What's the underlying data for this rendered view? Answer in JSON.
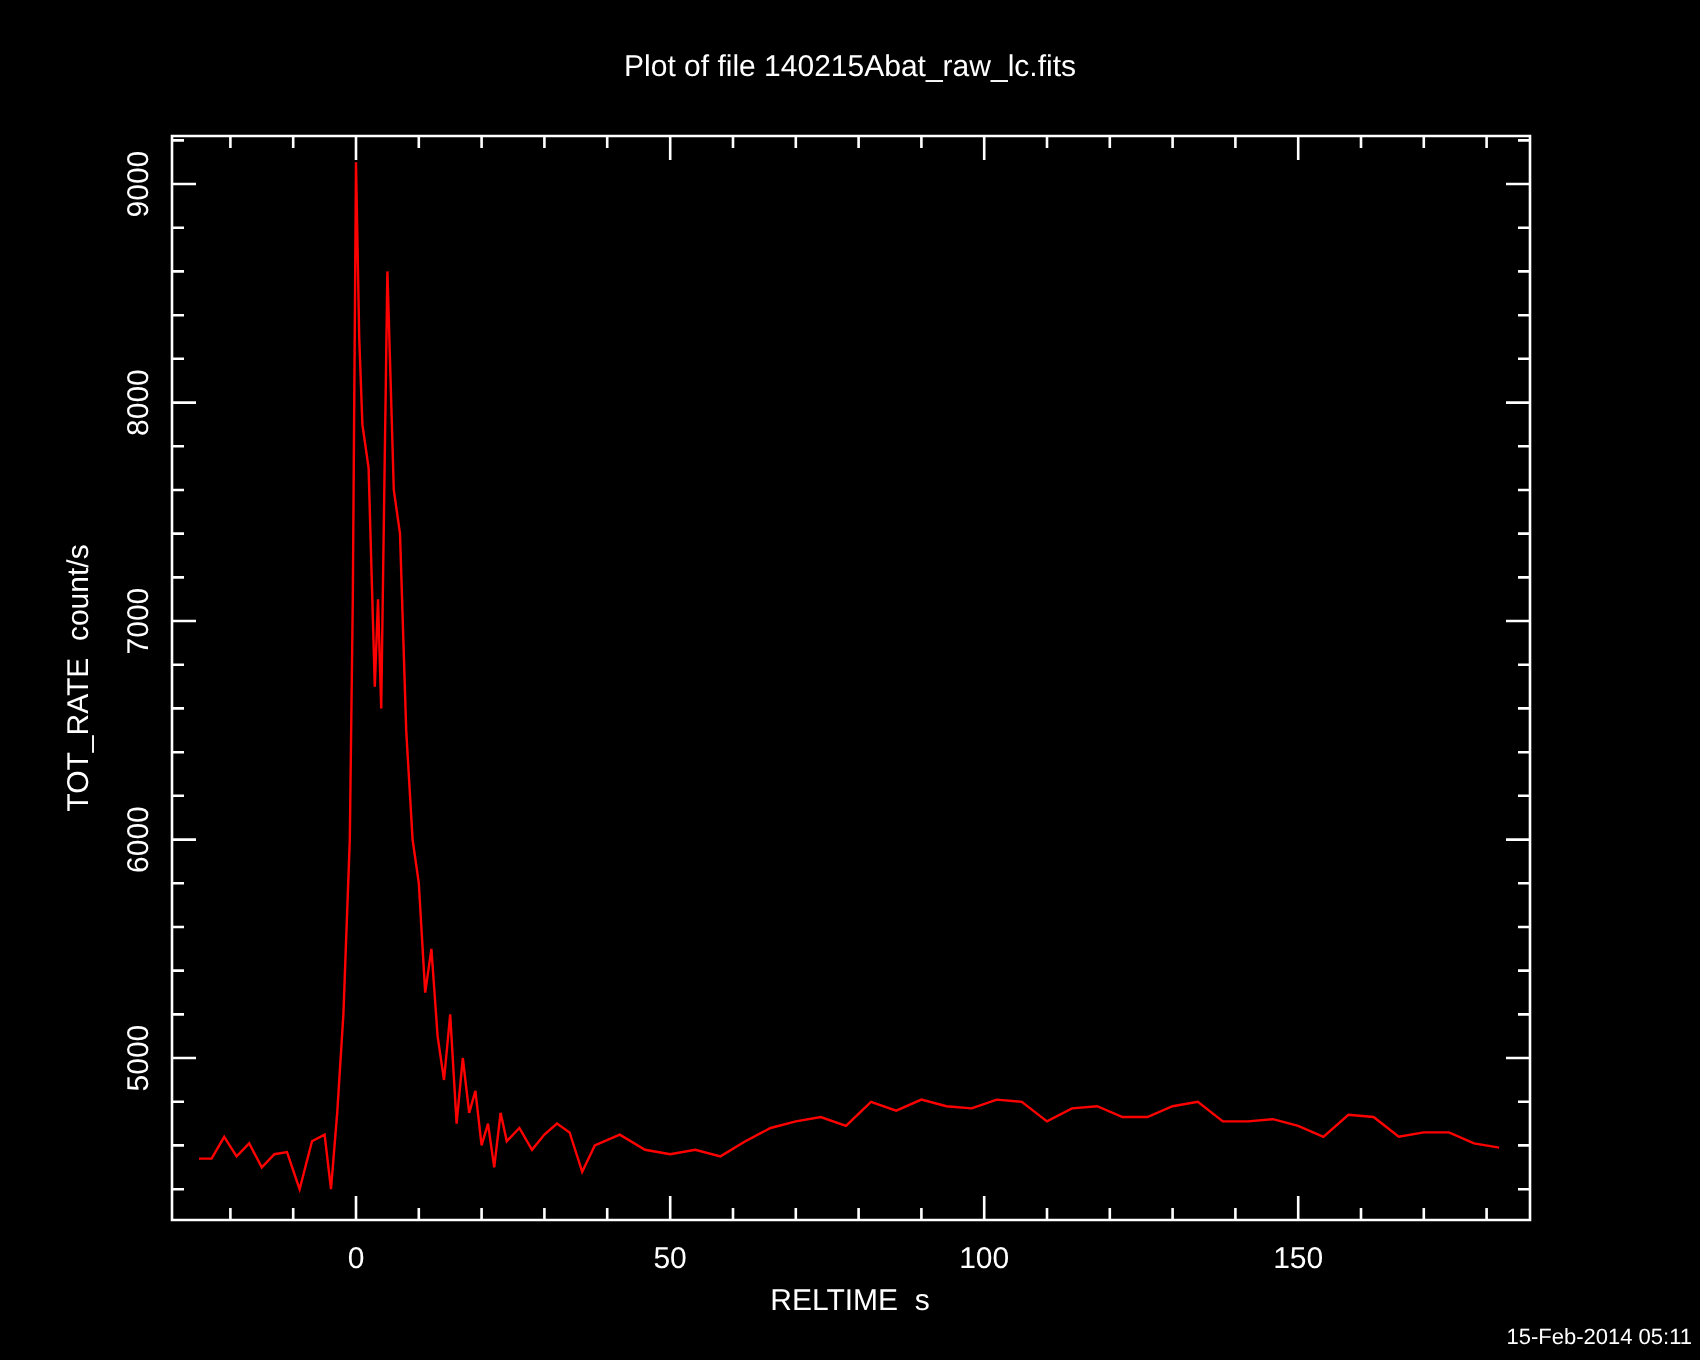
{
  "chart": {
    "chart_data": {
      "type": "line",
      "title": "Plot of file 140215Abat_raw_lc.fits",
      "xlabel": "RELTIME  s",
      "ylabel": "TOT_RATE  count/s",
      "x": [
        -25,
        -23,
        -21,
        -19,
        -17,
        -15,
        -13,
        -11,
        -9,
        -7,
        -5,
        -4,
        -3,
        -2,
        -1,
        -0.5,
        0,
        0.5,
        1,
        2,
        3,
        3.5,
        4,
        5,
        6,
        7,
        8,
        9,
        10,
        11,
        12,
        13,
        14,
        15,
        16,
        17,
        18,
        19,
        20,
        21,
        22,
        23,
        24,
        26,
        28,
        30,
        32,
        34,
        36,
        38,
        42,
        46,
        50,
        54,
        58,
        62,
        66,
        70,
        74,
        78,
        82,
        86,
        90,
        94,
        98,
        102,
        106,
        110,
        114,
        118,
        122,
        126,
        130,
        134,
        138,
        142,
        146,
        150,
        154,
        158,
        162,
        166,
        170,
        174,
        178,
        182
      ],
      "series": [
        {
          "color": "#ff0000",
          "values": [
            4540,
            4540,
            4640,
            4550,
            4610,
            4500,
            4560,
            4570,
            4400,
            4620,
            4650,
            4400,
            4750,
            5200,
            6000,
            7100,
            9100,
            8300,
            7900,
            7700,
            6700,
            7100,
            6600,
            8600,
            7600,
            7400,
            6500,
            6000,
            5800,
            5300,
            5500,
            5100,
            4900,
            5200,
            4700,
            5000,
            4750,
            4850,
            4600,
            4700,
            4500,
            4750,
            4620,
            4680,
            4580,
            4650,
            4700,
            4660,
            4480,
            4600,
            4650,
            4580,
            4560,
            4580,
            4550,
            4620,
            4680,
            4710,
            4730,
            4690,
            4800,
            4760,
            4810,
            4780,
            4770,
            4810,
            4800,
            4710,
            4770,
            4780,
            4730,
            4730,
            4780,
            4800,
            4710,
            4710,
            4720,
            4690,
            4640,
            4740,
            4730,
            4640,
            4660,
            4660,
            4610,
            4590
          ]
        }
      ],
      "xlim": [
        -29.3,
        186.9
      ],
      "ylim": [
        4259,
        9220
      ],
      "xticks": [
        0,
        50,
        100,
        150
      ],
      "yticks": [
        5000,
        6000,
        7000,
        8000,
        9000
      ]
    }
  },
  "timestamp": "15-Feb-2014 05:11"
}
